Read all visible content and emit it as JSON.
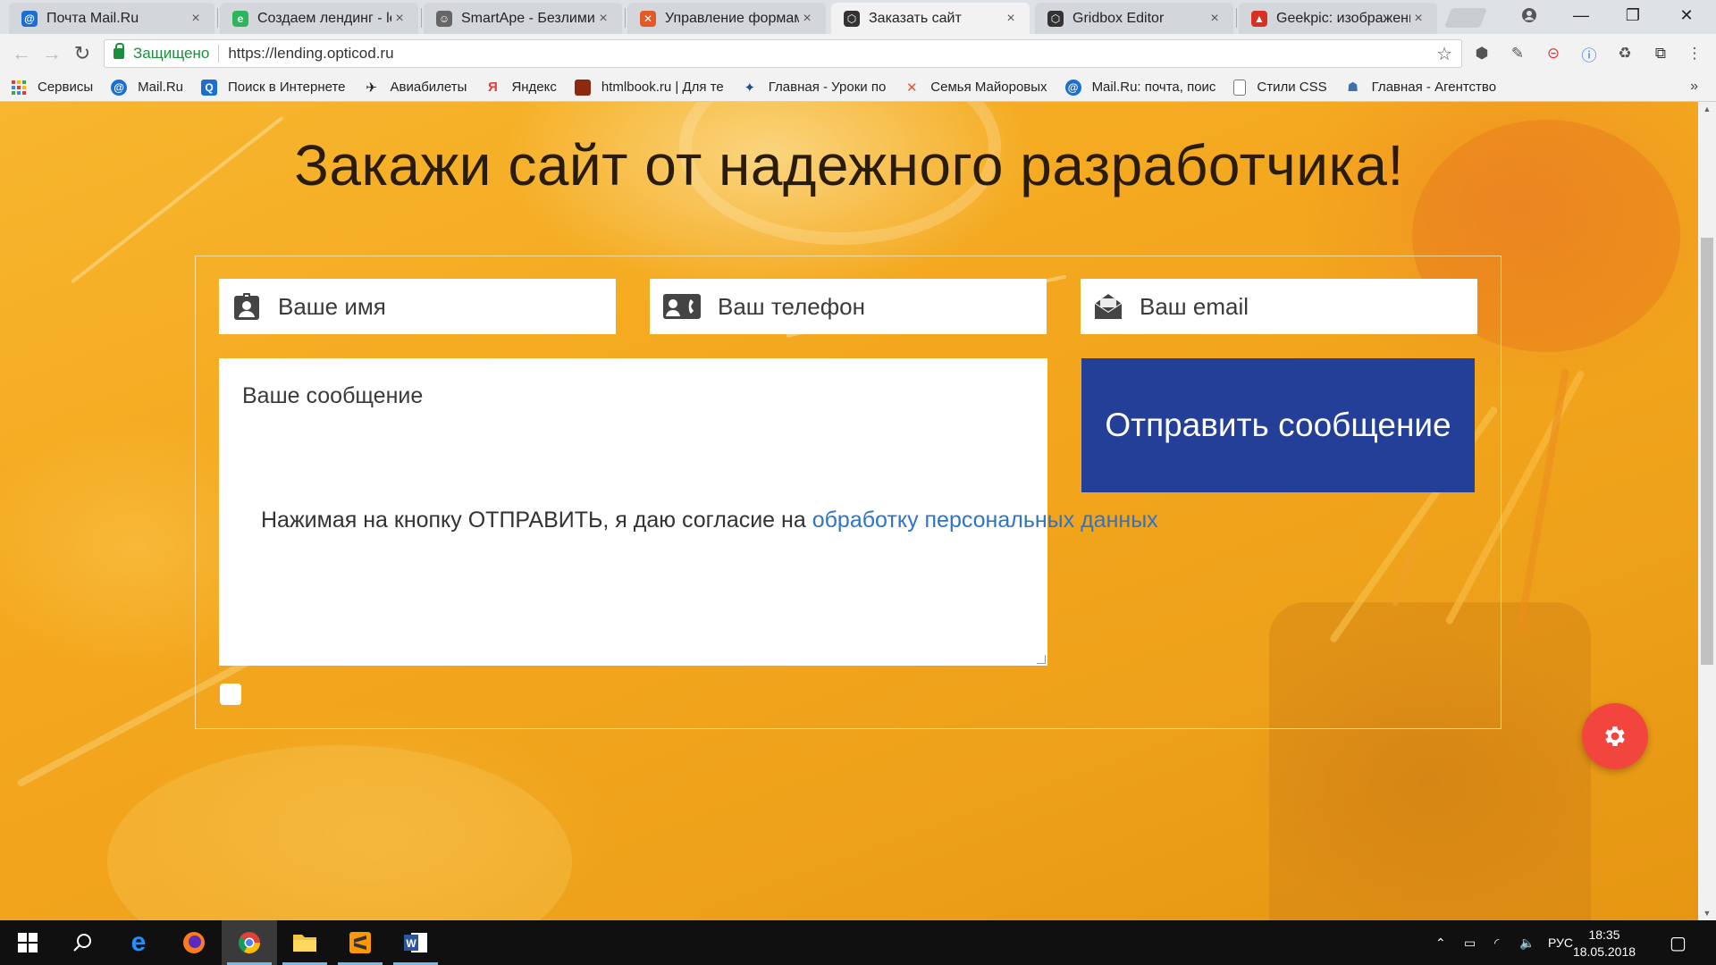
{
  "browser": {
    "tabs": [
      {
        "title": "Почта Mail.Ru",
        "favicon_color": "#1a6fd0",
        "favicon_glyph": "@"
      },
      {
        "title": "Создаем лендинг - len",
        "favicon_color": "#2db55d",
        "favicon_glyph": "e"
      },
      {
        "title": "SmartApe - Безлимитн",
        "favicon_color": "#555555",
        "favicon_glyph": "☺"
      },
      {
        "title": "Управление формами",
        "favicon_color": "#e05a2a",
        "favicon_glyph": "✕"
      },
      {
        "title": "Заказать сайт",
        "favicon_color": "#333333",
        "favicon_glyph": "⬡"
      },
      {
        "title": "Gridbox Editor",
        "favicon_color": "#333333",
        "favicon_glyph": "⬡"
      },
      {
        "title": "Geekpic: изображение",
        "favicon_color": "#d93025",
        "favicon_glyph": "▲"
      }
    ],
    "active_tab_index": 4,
    "tab_close_glyph": "×",
    "secure_label": "Защищено",
    "url": "https://lending.opticod.ru",
    "bookmarks": [
      {
        "label": "Сервисы",
        "icon": "apps-grid-icon",
        "color": "#e53935"
      },
      {
        "label": "Mail.Ru",
        "icon": "mailru-icon",
        "color": "#1a6fd0"
      },
      {
        "label": "Поиск в Интернете",
        "icon": "search-icon",
        "color": "#1a6fd0"
      },
      {
        "label": "Авиабилеты",
        "icon": "plane-icon",
        "color": "#333333"
      },
      {
        "label": "Яндекс",
        "icon": "yandex-icon",
        "color": "#e53935"
      },
      {
        "label": "htmlbook.ru | Для те",
        "icon": "htmlbook-icon",
        "color": "#8b2a0e"
      },
      {
        "label": "Главная - Уроки по",
        "icon": "joomla-icon",
        "color": "#1a4f8a"
      },
      {
        "label": "Семья Майоровых",
        "icon": "joomla-icon",
        "color": "#e05a2a"
      },
      {
        "label": "Mail.Ru: почта, поис",
        "icon": "mailru-icon",
        "color": "#1a6fd0"
      },
      {
        "label": "Стили CSS",
        "icon": "page-icon",
        "color": "#777777"
      },
      {
        "label": "Главная - Агентство",
        "icon": "agency-icon",
        "color": "#3a6fb0"
      }
    ]
  },
  "page": {
    "headline": "Закажи сайт от надежного разработчика!",
    "fields": {
      "name_placeholder": "Ваше имя",
      "phone_placeholder": "Ваш телефон",
      "email_placeholder": "Ваш email",
      "message_placeholder": "Ваше сообщение"
    },
    "submit_label": "Отправить сообщение",
    "consent_text": "Нажимая на кнопку ОТПРАВИТЬ, я даю согласие на",
    "consent_link": "обработку персональных данных",
    "colors": {
      "submit": "#233f97",
      "link": "#2f74c6",
      "fab": "#f2453d"
    }
  },
  "taskbar": {
    "language": "РУС",
    "time": "18:35",
    "date": "18.05.2018"
  }
}
